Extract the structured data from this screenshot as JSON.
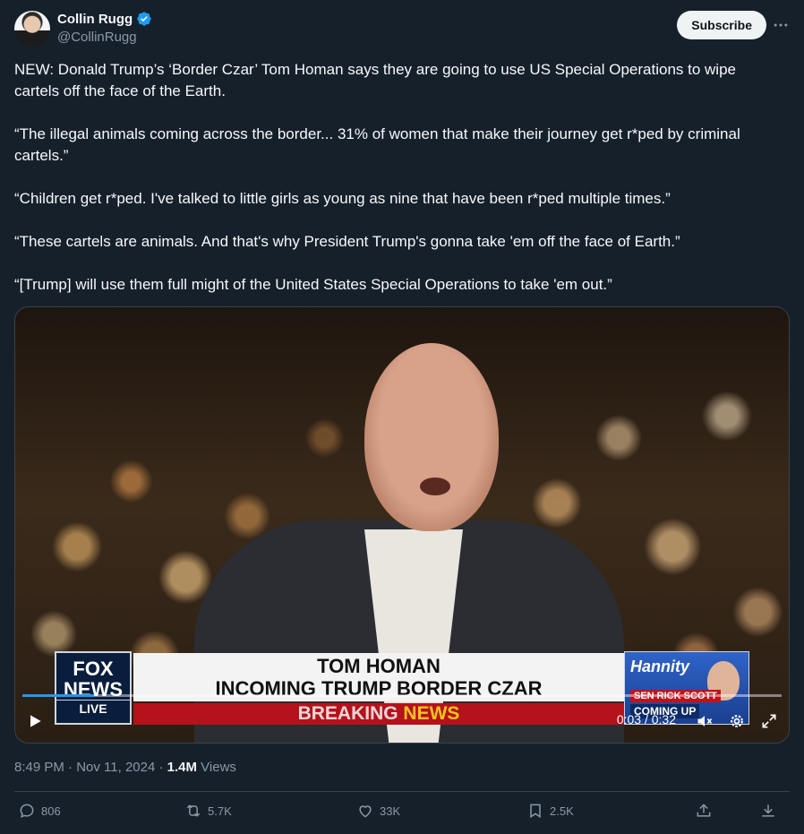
{
  "author": {
    "name": "Collin Rugg",
    "handle": "@CollinRugg"
  },
  "subscribe_label": "Subscribe",
  "tweet_paragraphs": [
    "NEW: Donald Trump’s ‘Border Czar’ Tom Homan says they are going to use US Special Operations to wipe cartels off the face of the Earth.",
    "“The illegal animals coming across the border... 31% of women that make their journey get r*ped by criminal cartels.”",
    "“Children get r*ped. I've talked to little girls as young as nine that have been r*ped multiple times.”",
    "“These cartels are animals. And that's why President Trump's gonna take 'em off the face of Earth.”",
    "“[Trump] will use them full might of the United States Special Operations to take 'em out.”"
  ],
  "video": {
    "chyron_line1": "TOM HOMAN",
    "chyron_line2": "INCOMING TRUMP BORDER CZAR",
    "breaking_word1": "BREAKING",
    "breaking_word2": "NEWS",
    "network_line1": "FOX",
    "network_line2": "NEWS",
    "network_line3": "LIVE",
    "promo_show": "Hannity",
    "promo_guest": "SEN RICK SCOTT",
    "promo_soon": "COMING UP",
    "time": "0:03 / 0:32",
    "progress": 0.094
  },
  "meta": {
    "time": "8:49 PM · Nov 11, 2024 · ",
    "views_count": "1.4M",
    "views_label": " Views"
  },
  "actions": {
    "replies": "806",
    "reposts": "5.7K",
    "likes": "33K",
    "bookmarks": "2.5K"
  },
  "colors": {
    "background": "#15202b",
    "accent": "#1d9bf0",
    "muted": "#8b98a5"
  }
}
